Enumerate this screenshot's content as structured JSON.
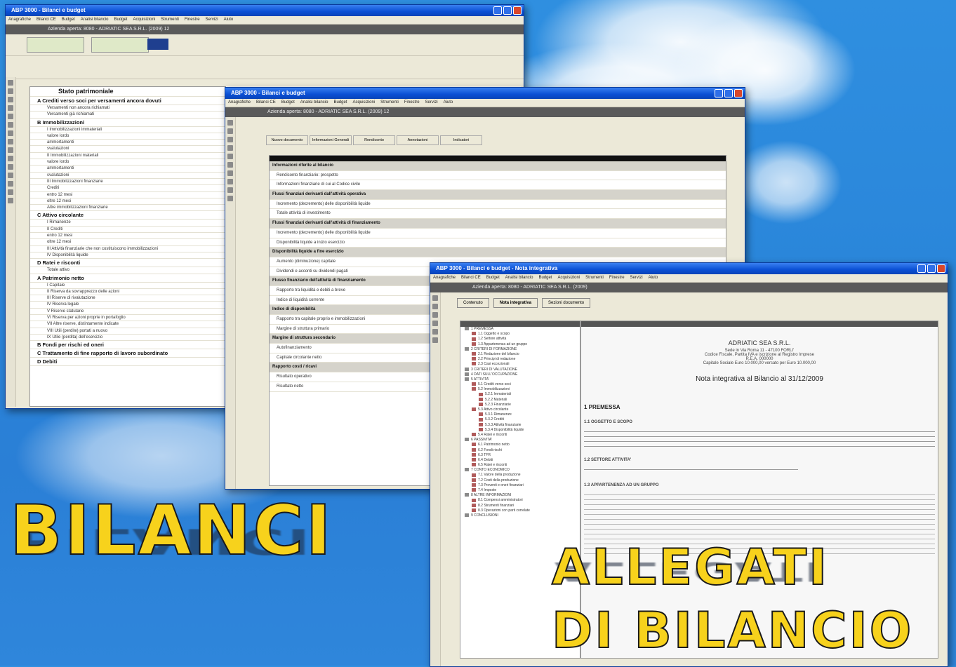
{
  "win1": {
    "title": "ABP 3000 - Bilanci e budget",
    "menu": [
      "Anagrafiche",
      "Bilanci CE",
      "Budget",
      "Analisi bilancio",
      "Budget",
      "Acquisizioni",
      "Strumenti",
      "Finestre",
      "Servizi",
      "Aiuto"
    ],
    "company": "Azienda aperta: 8080 - ADRIATIC SEA S.R.L. (2009) 12",
    "section_title": "Stato patrimoniale",
    "rows": [
      "A   Crediti verso soci per versamenti ancora dovuti",
      "Versamenti non ancora richiamati",
      "Versamenti già richiamati",
      "B   Immobilizzazioni",
      "I   Immobilizzazioni immateriali",
      "valore lordo",
      "ammortamenti",
      "svalutazioni",
      "II  Immobilizzazioni materiali",
      "valore lordo",
      "ammortamenti",
      "svalutazioni",
      "III Immobilizzazioni finanziarie",
      "Crediti",
      "entro 12 mesi",
      "oltre 12 mesi",
      "Altre immobilizzazioni finanziarie",
      "C   Attivo circolante",
      "I   Rimanenze",
      "II  Crediti",
      "entro 12 mesi",
      "oltre 12 mesi",
      "III Attività finanziarie che non costituiscono immobilizzazioni",
      "IV  Disponibilità liquide",
      "D   Ratei e risconti",
      "Totale attivo",
      "A   Patrimonio netto",
      "I   Capitale",
      "II  Riserva da sovrapprezzo delle azioni",
      "III Riserve di rivalutazione",
      "IV  Riserva legale",
      "V   Riserve statutarie",
      "VI  Riserva per azioni proprie in portafoglio",
      "VII Altre riserve, distintamente indicate",
      "VIII Utili (perdite) portati a nuovo",
      "IX  Utile (perdita) dell'esercizio",
      "B   Fondi per rischi ed oneri",
      "C   Trattamento di fine rapporto di lavoro subordinato",
      "D   Debiti"
    ]
  },
  "win2": {
    "title": "ABP 3000 - Bilanci e budget",
    "company": "Azienda aperta: 8080 - ADRIATIC SEA S.R.L. (2009) 12",
    "tabs": [
      "Nuovo documento",
      "Informazioni Generali",
      "Rendiconto",
      "Annotazioni",
      "Indicatori"
    ],
    "rows": [
      "Informazioni riferite al bilancio",
      "Rendiconto finanziario: prospetto",
      "Informazioni finanziarie di cui al Codice civile",
      "Flussi finanziari derivanti dall'attività operativa",
      "Incremento (decremento) delle disponibilità liquide",
      "Totale attività di investimento",
      "Flussi finanziari derivanti dall'attività di finanziamento",
      "Incremento (decremento) delle disponibilità liquide",
      "Disponibilità liquide a inizio esercizio",
      "Disponibilità liquide a fine esercizio",
      "Aumento (diminuzione) capitale",
      "Dividendi e acconti su dividendi pagati",
      "Flusso finanziario dell'attività di finanziamento",
      "Rapporto tra liquidità e debiti a breve",
      "Indice di liquidità corrente",
      "Indice di disponibilità",
      "Rapporto tra capitale proprio e immobilizzazioni",
      "Margine di struttura primario",
      "Margine di struttura secondario",
      "Autofinanziamento",
      "Capitale circolante netto",
      "Rapporto costi / ricavi",
      "Risultato operativo",
      "Risultato netto"
    ]
  },
  "win3": {
    "title": "ABP 3000 - Bilanci e budget - Nota integrativa",
    "company": "Azienda aperta: 8080 - ADRIATIC SEA S.R.L. (2009)",
    "buttons": [
      "Contenuto",
      "Nota integrativa",
      "Sezioni documento"
    ],
    "doc_company": "ADRIATIC SEA S.R.L.",
    "doc_line1": "Sede in Via Roma 11 - 47100 FORLI'",
    "doc_line2": "Codice Fiscale, Partita IVA e iscrizione al Registro Imprese",
    "doc_line3": "R.E.A. 000000",
    "doc_line4": "Capitale Sociale Euro 10.000,00 versato per Euro 10.000,00",
    "doc_title": "Nota integrativa al Bilancio al 31/12/2009",
    "h1": "1 PREMESSA",
    "h11": "1.1 OGGETTO E SCOPO",
    "h12": "1.2 SETTORE ATTIVITA'",
    "h13": "1.3 APPARTENENZA AD UN GRUPPO",
    "tree": [
      "1 PREMESSA",
      "1.1 Oggetto e scopo",
      "1.2 Settore attività",
      "1.3 Appartenenza ad un gruppo",
      "2 CRITERI DI FORMAZIONE",
      "2.1 Redazione del bilancio",
      "2.2 Principi di redazione",
      "2.3 Casi eccezionali",
      "3 CRITERI DI VALUTAZIONE",
      "4 DATI SULL'OCCUPAZIONE",
      "5 ATTIVITA'",
      "5.1 Crediti verso soci",
      "5.2 Immobilizzazioni",
      "5.2.1 Immateriali",
      "5.2.2 Materiali",
      "5.2.3 Finanziarie",
      "5.3 Attivo circolante",
      "5.3.1 Rimanenze",
      "5.3.2 Crediti",
      "5.3.3 Attività finanziarie",
      "5.3.4 Disponibilità liquide",
      "5.4 Ratei e risconti",
      "6 PASSIVITA'",
      "6.1 Patrimonio netto",
      "6.2 Fondi rischi",
      "6.3 TFR",
      "6.4 Debiti",
      "6.5 Ratei e risconti",
      "7 CONTO ECONOMICO",
      "7.1 Valore della produzione",
      "7.2 Costi della produzione",
      "7.3 Proventi e oneri finanziari",
      "7.4 Imposte",
      "8 ALTRE INFORMAZIONI",
      "8.1 Compensi amministratori",
      "8.2 Strumenti finanziari",
      "8.3 Operazioni con parti correlate",
      "9 CONCLUSIONI"
    ]
  },
  "overlay": {
    "bilanci": "BILANCI",
    "allegati": "ALLEGATI",
    "di_bilancio": "DI BILANCIO"
  }
}
